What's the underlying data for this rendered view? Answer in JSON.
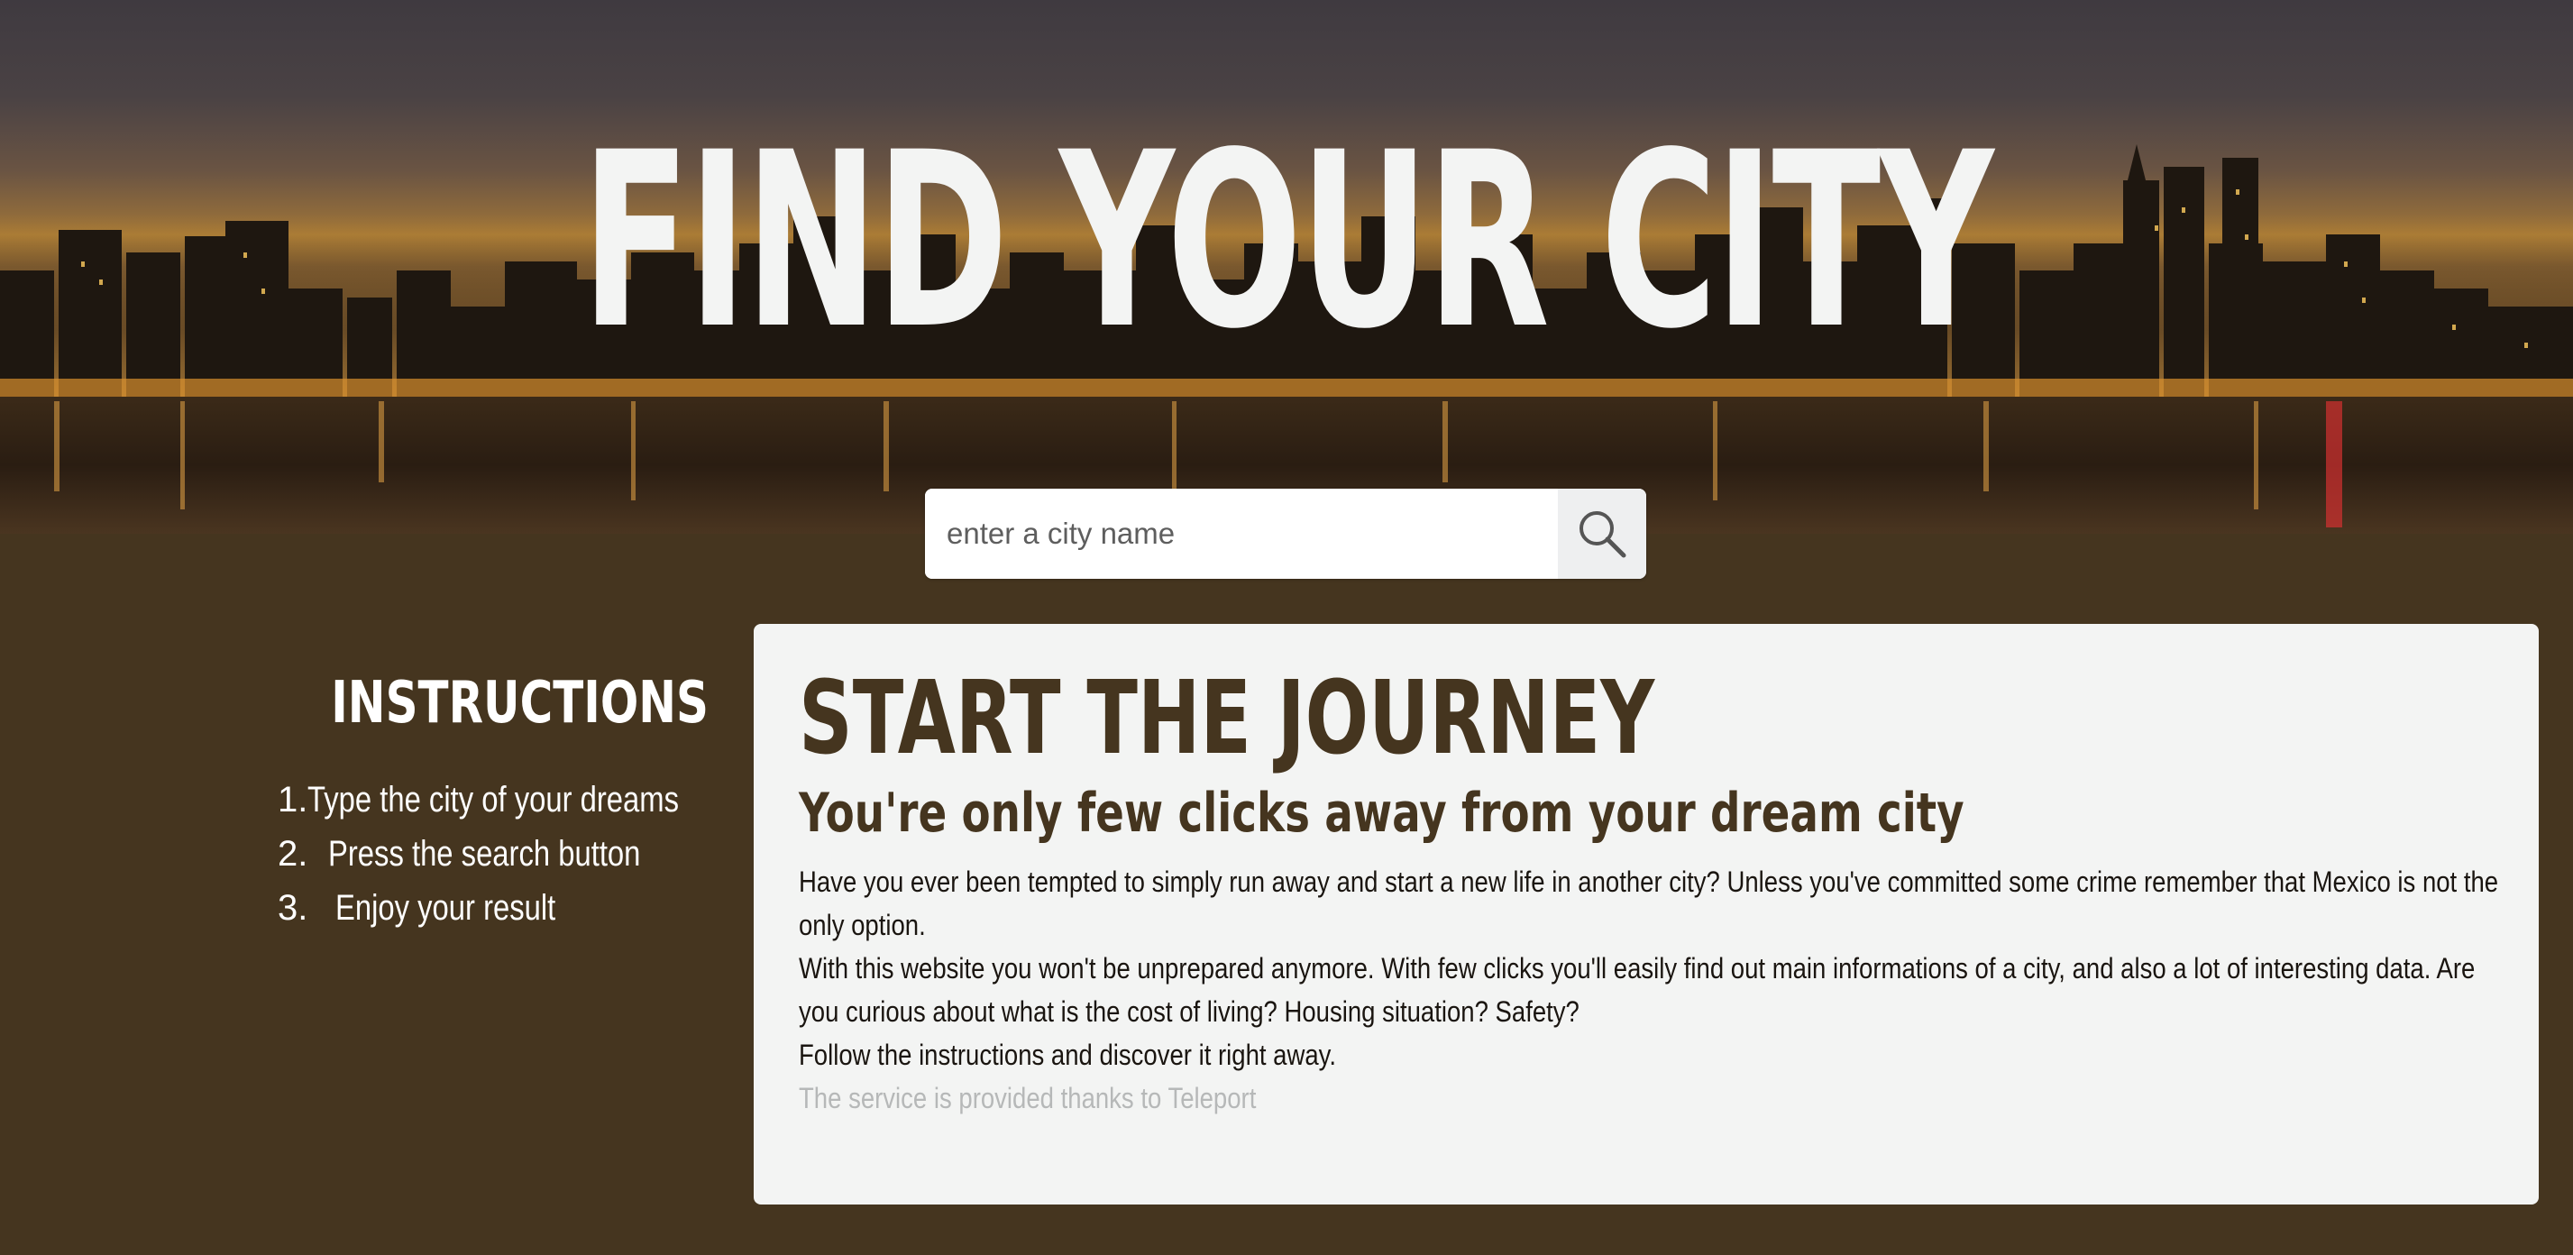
{
  "hero": {
    "title": "FIND YOUR CITY"
  },
  "search": {
    "placeholder": "enter a city name",
    "icon": "search-icon"
  },
  "instructions": {
    "title": "INSTRUCTIONS",
    "steps": [
      {
        "number": "1.",
        "text": "Type the city of your dreams"
      },
      {
        "number": "2.",
        "text": "Press the search button"
      },
      {
        "number": "3.",
        "text": "Enjoy your result"
      }
    ]
  },
  "card": {
    "heading": "START THE JOURNEY",
    "subheading": "You're only few clicks away from your dream city",
    "paragraphs": [
      "Have you ever been tempted to simply run away and start a new life in another city? Unless you've committed some crime remember that Mexico is not the only option.",
      "With this website you won't be unprepared anymore. With few clicks you'll easily find out main informations of a city, and also a lot of interesting data. Are you curious about what is the cost of living? Housing situation? Safety?",
      "Follow the instructions and discover it right away."
    ],
    "credit": "The service is provided thanks to Teleport"
  },
  "colors": {
    "page_background": "#45351f",
    "card_background": "#f3f4f3",
    "heading_color": "#45351f",
    "hero_text": "#f3f4f3",
    "credit_text": "#b6b8b8"
  }
}
